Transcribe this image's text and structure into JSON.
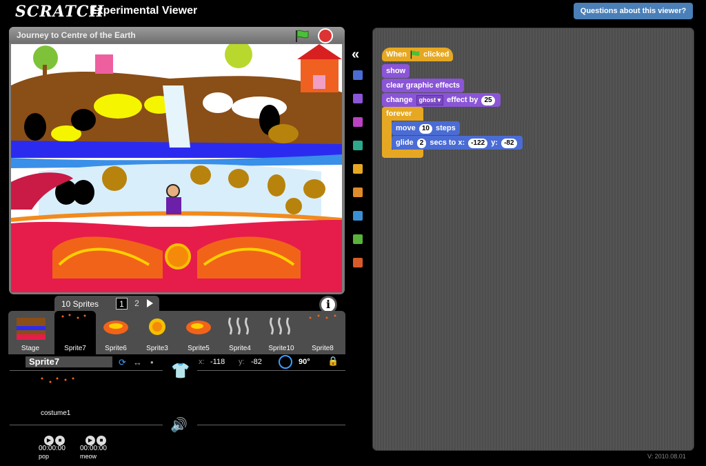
{
  "header": {
    "logo": "SCRATCH",
    "title": "Experimental Viewer",
    "questions_button": "Questions about this viewer?"
  },
  "stage": {
    "project_title": "Journey to Centre of the Earth"
  },
  "sprites": {
    "count_label": "10 Sprites",
    "pages": [
      "1",
      "2"
    ],
    "list": [
      {
        "name": "Stage"
      },
      {
        "name": "Sprite7"
      },
      {
        "name": "Sprite6"
      },
      {
        "name": "Sprite3"
      },
      {
        "name": "Sprite5"
      },
      {
        "name": "Sprite4"
      },
      {
        "name": "Sprite10"
      },
      {
        "name": "Sprite8"
      }
    ]
  },
  "selected_sprite": {
    "name": "Sprite7",
    "x_label": "x:",
    "x": "-118",
    "y_label": "y:",
    "y": "-82",
    "direction": "90°",
    "costume_name": "costume1",
    "sounds": [
      {
        "name": "pop",
        "time": "00:00:00"
      },
      {
        "name": "meow",
        "time": "00:00:00"
      }
    ]
  },
  "palette_colors": [
    "#4a6cd4",
    "#8a55d7",
    "#bb42c3",
    "#2ca98a",
    "#e6a822",
    "#e08a2a",
    "#3a8fd4",
    "#59b33a",
    "#d75b2a"
  ],
  "scripts": {
    "when_label": "When",
    "clicked_label": "clicked",
    "show": "show",
    "clear_effects": "clear graphic effects",
    "change_label": "change",
    "ghost_option": "ghost",
    "effect_by_label": "effect by",
    "effect_value": "25",
    "forever": "forever",
    "move_label": "move",
    "move_value": "10",
    "steps_label": "steps",
    "glide_label": "glide",
    "glide_secs": "2",
    "secs_to_x_label": "secs to x:",
    "glide_x": "-122",
    "y_label": "y:",
    "glide_y": "-82"
  },
  "footer": {
    "version": "V: 2010.08.01"
  }
}
